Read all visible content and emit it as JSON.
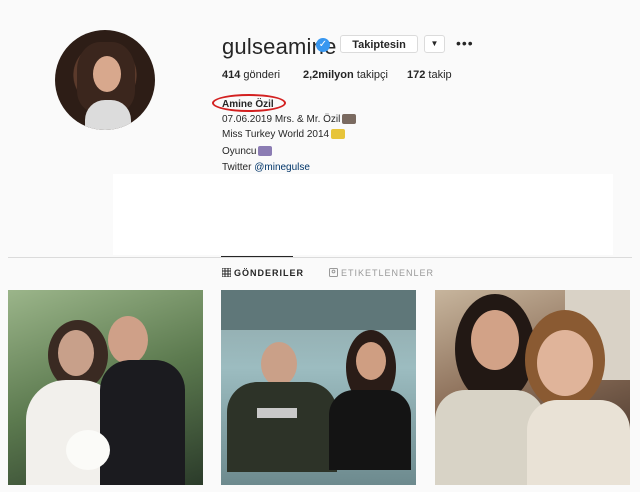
{
  "profile": {
    "username": "gulseamine",
    "follow_button": "Takiptesin",
    "more_label": "•••"
  },
  "stats": {
    "posts_count": "414",
    "posts_label": "gönderi",
    "followers_count": "2,2milyon",
    "followers_label": "takipçi",
    "following_count": "172",
    "following_label": "takip"
  },
  "bio": {
    "name": "Amine Özil",
    "line1": "07.06.2019 Mrs. & Mr. Özil",
    "line2": "Miss Turkey World 2014",
    "line3": "Oyuncu",
    "twitter_label": "Twitter",
    "twitter_handle": "@minegulse"
  },
  "tabs": {
    "posts": "GÖNDERILER",
    "tagged": "ETIKETLENENLER"
  },
  "colors": {
    "accent": "#3897f0",
    "annotation": "#d32020"
  }
}
